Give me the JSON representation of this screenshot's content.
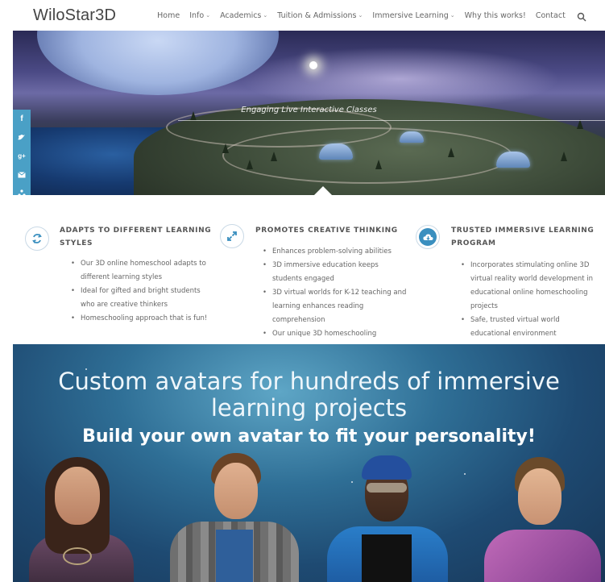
{
  "nav": {
    "logo": "WiloStar3D",
    "items": [
      {
        "label": "Home",
        "dropdown": false
      },
      {
        "label": "Info",
        "dropdown": true
      },
      {
        "label": "Academics",
        "dropdown": true
      },
      {
        "label": "Tuition & Admissions",
        "dropdown": true
      },
      {
        "label": "Immersive Learning",
        "dropdown": true
      },
      {
        "label": "Why this works!",
        "dropdown": false
      },
      {
        "label": "Contact",
        "dropdown": false
      }
    ],
    "search_icon": "search-icon"
  },
  "hero": {
    "caption": "Engaging Live Interactive Classes"
  },
  "social": [
    "f",
    "t",
    "g+",
    "m",
    "sh",
    "rd"
  ],
  "features": [
    {
      "icon": "refresh-icon",
      "title": "Adapts to different learning styles",
      "items": [
        "Our 3D online homeschool adapts to different learning styles",
        "Ideal for gifted and bright students who are creative thinkers",
        "Homeschooling approach that is fun!"
      ]
    },
    {
      "icon": "expand-icon",
      "title": "Promotes creative thinking",
      "items": [
        "Enhances problem-solving abilities",
        "3D immersive education keeps students engaged",
        "3D virtual worlds for K-12 teaching and learning enhances reading comprehension",
        "Our unique 3D homeschooling"
      ]
    },
    {
      "icon": "cloud-download-icon",
      "title": "Trusted immersive learning program",
      "items": [
        "Incorporates stimulating online 3D virtual reality world development in educational online homeschooling projects",
        "Safe, trusted virtual world educational environment"
      ]
    }
  ],
  "avatars": {
    "title": "Custom avatars for hundreds of immersive learning projects",
    "subtitle": "Build your own avatar to fit your personality!"
  },
  "colors": {
    "accent": "#3a8fbf",
    "social_bar": "#4aa0c6"
  }
}
